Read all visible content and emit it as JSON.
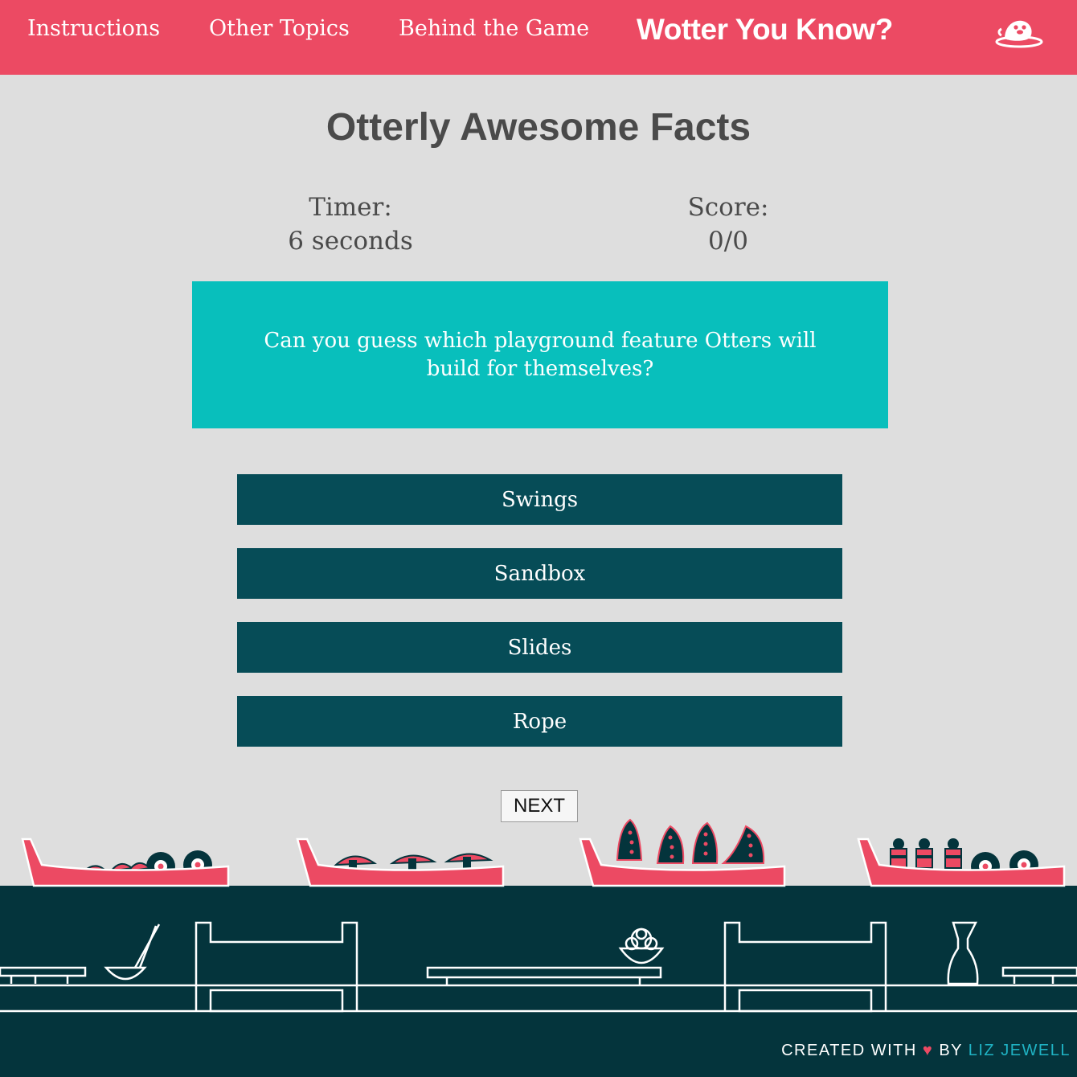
{
  "nav": {
    "links": [
      "Instructions",
      "Other Topics",
      "Behind the Game"
    ],
    "brand": "Wotter You Know?",
    "logo_icon": "otter-logo-icon"
  },
  "game": {
    "title": "Otterly Awesome Facts",
    "timer_label": "Timer:",
    "timer_value": "6 seconds",
    "score_label": "Score:",
    "score_value": "0/0",
    "question": "Can you guess which playground feature Otters will build for themselves?",
    "answers": [
      "Swings",
      "Sandbox",
      "Slides",
      "Rope"
    ],
    "next_label": "NEXT"
  },
  "footer": {
    "created_with": "CREATED WITH",
    "heart": "♥",
    "by": "BY",
    "author": "LIZ JEWELL"
  },
  "colors": {
    "nav_bg": "#ec4a63",
    "question_bg": "#08bfbc",
    "answer_bg": "#064c57",
    "footer_bg": "#04343c",
    "page_bg": "#dedede"
  }
}
